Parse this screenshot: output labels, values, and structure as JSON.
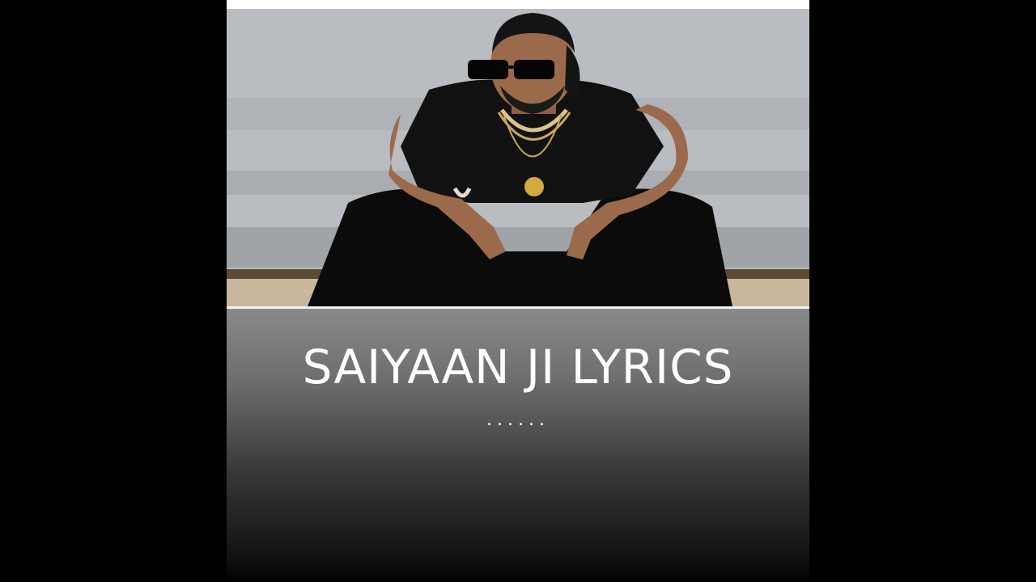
{
  "video": {
    "title": "SAIYAAN JI LYRICS",
    "subtitle": "......"
  },
  "photo": {
    "subject": "man seated in black sleeveless outfit with sunglasses and gold chains",
    "icon": "person-photo"
  },
  "colors": {
    "letterbox": "#000000",
    "text": "#ffffff",
    "gradient_top": "#8a8a8a",
    "gradient_bottom": "#000000"
  }
}
